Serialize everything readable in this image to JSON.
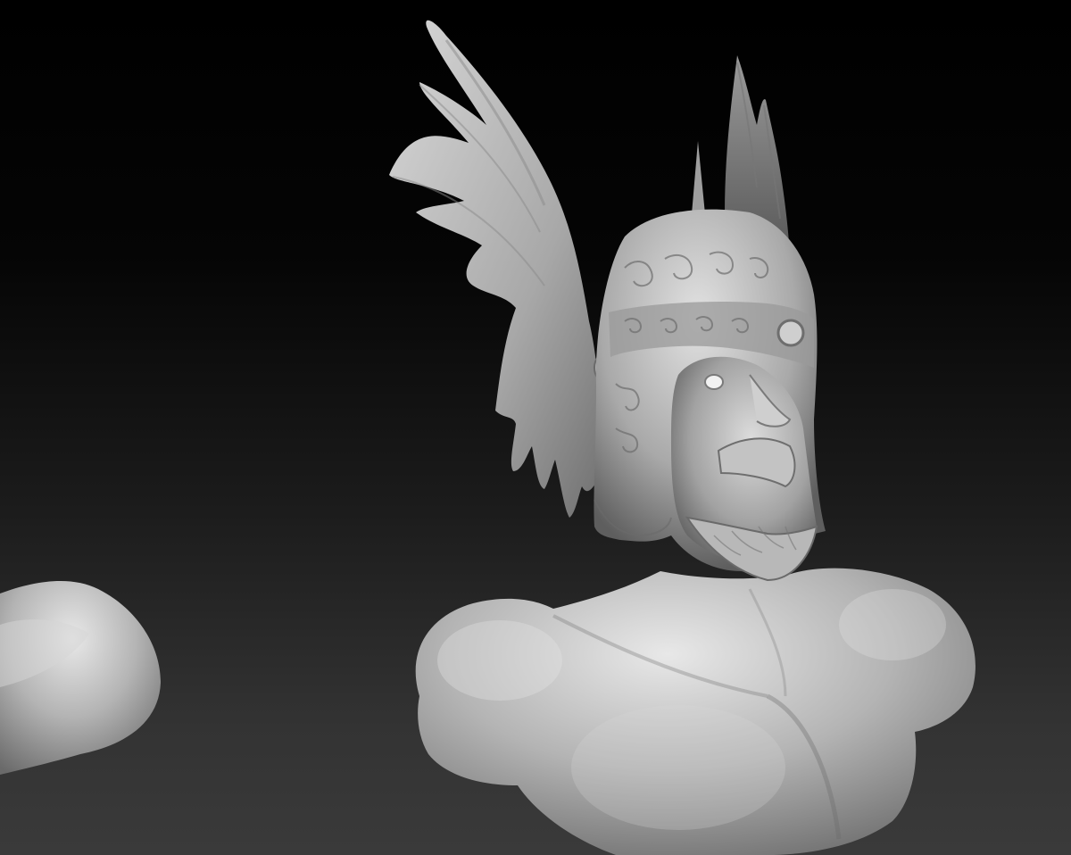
{
  "viewport": {
    "background_top": "#000000",
    "background_bottom": "#3a3a3a"
  },
  "model": {
    "material_color": "#c8c8c8",
    "shadow_color": "#555555",
    "highlight_color": "#f2f2f2"
  }
}
